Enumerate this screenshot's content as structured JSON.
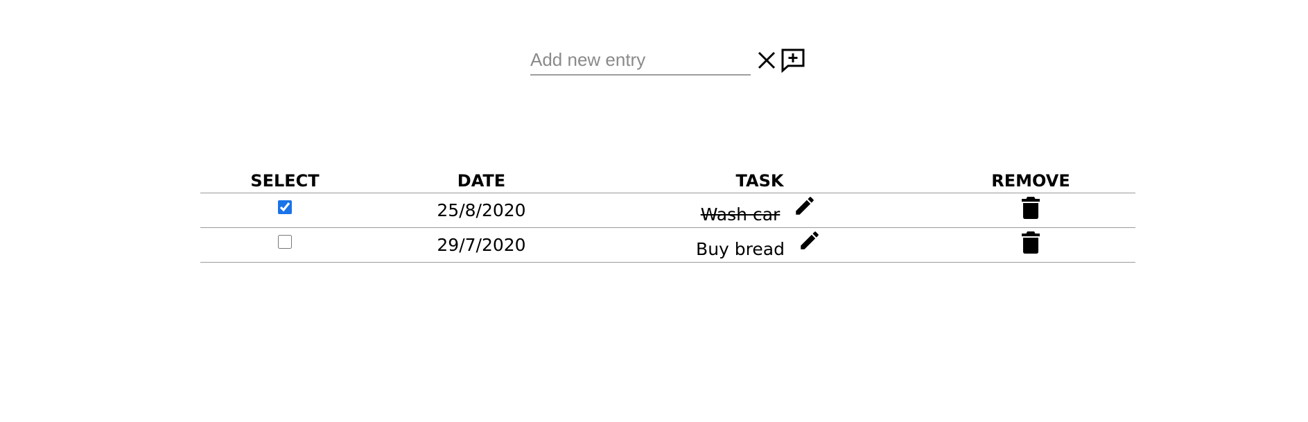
{
  "entry": {
    "placeholder": "Add new entry",
    "value": "",
    "clear_icon": "close-icon",
    "add_icon": "comment-plus-icon"
  },
  "table": {
    "headers": {
      "select": "SELECT",
      "date": "DATE",
      "task": "TASK",
      "remove": "REMOVE"
    },
    "rows": [
      {
        "checked": true,
        "date": "25/8/2020",
        "task": "Wash car",
        "done": true,
        "edit_icon": "pencil-icon",
        "remove_icon": "trash-icon"
      },
      {
        "checked": false,
        "date": "29/7/2020",
        "task": "Buy bread",
        "done": false,
        "edit_icon": "pencil-icon",
        "remove_icon": "trash-icon"
      }
    ]
  },
  "colors": {
    "checkbox_accent": "#1a73e8",
    "divider": "#9a9a9a",
    "input_underline": "#9e9e9e",
    "placeholder": "#8a8a8a"
  }
}
